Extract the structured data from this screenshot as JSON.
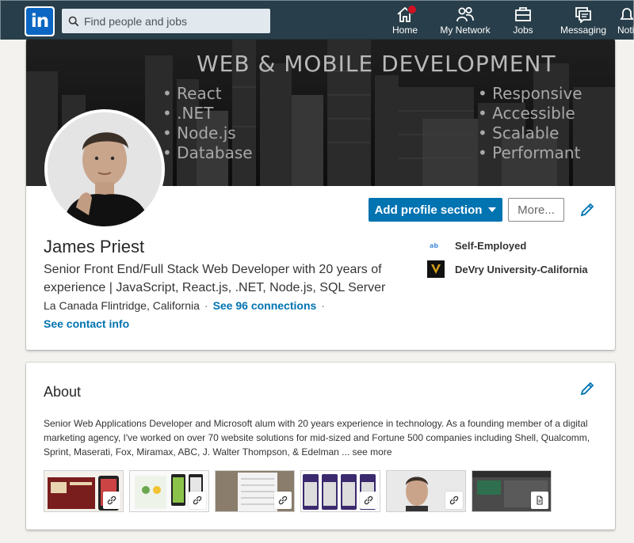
{
  "nav": {
    "logo_text": "in",
    "search_placeholder": "Find people and jobs",
    "items": [
      {
        "label": "Home",
        "icon": "home-icon",
        "badge": true
      },
      {
        "label": "My Network",
        "icon": "network-icon"
      },
      {
        "label": "Jobs",
        "icon": "briefcase-icon"
      },
      {
        "label": "Messaging",
        "icon": "messaging-icon"
      },
      {
        "label": "Noti",
        "icon": "bell-icon"
      }
    ]
  },
  "banner": {
    "title": "WEB & MOBILE DEVELOPMENT",
    "left_list": [
      "React",
      ".NET",
      "Node.js",
      "Database"
    ],
    "right_list": [
      "Responsive",
      "Accessible",
      "Scalable",
      "Performant"
    ]
  },
  "profile": {
    "name": "James Priest",
    "headline": "Senior Front End/Full Stack Web Developer with 20 years of experience | JavaScript, React.js, .NET, Node.js, SQL Server",
    "location": "La Canada Flintridge, California",
    "sep": "·",
    "connections": "See 96 connections",
    "contact": "See contact info",
    "add_section_label": "Add profile section",
    "more_label": "More...",
    "experience": [
      {
        "label": "Self-Employed",
        "icon": "company-icon"
      },
      {
        "label": "DeVry University-California",
        "icon": "devry-logo-icon"
      }
    ]
  },
  "about": {
    "heading": "About",
    "text": "Senior Web Applications Developer and Microsoft alum with 20 years experience in technology. As a founding member of a digital marketing agency, I've worked on over 70 website solutions for mid-sized and Fortune 500 companies including Shell, Qualcomm, Sprint, Maserati, Fox, Miramax, ABC, J. Walter Thompson, & Edelman ...",
    "see_more": "see more",
    "media": [
      {
        "icon": "link-icon"
      },
      {
        "icon": "link-icon"
      },
      {
        "icon": "link-icon"
      },
      {
        "icon": "link-icon"
      },
      {
        "icon": "link-icon"
      },
      {
        "icon": "document-icon"
      }
    ]
  },
  "colors": {
    "nav_bg": "#283e4a",
    "brand_blue": "#0073b1",
    "page_bg": "#f3f2ef"
  }
}
